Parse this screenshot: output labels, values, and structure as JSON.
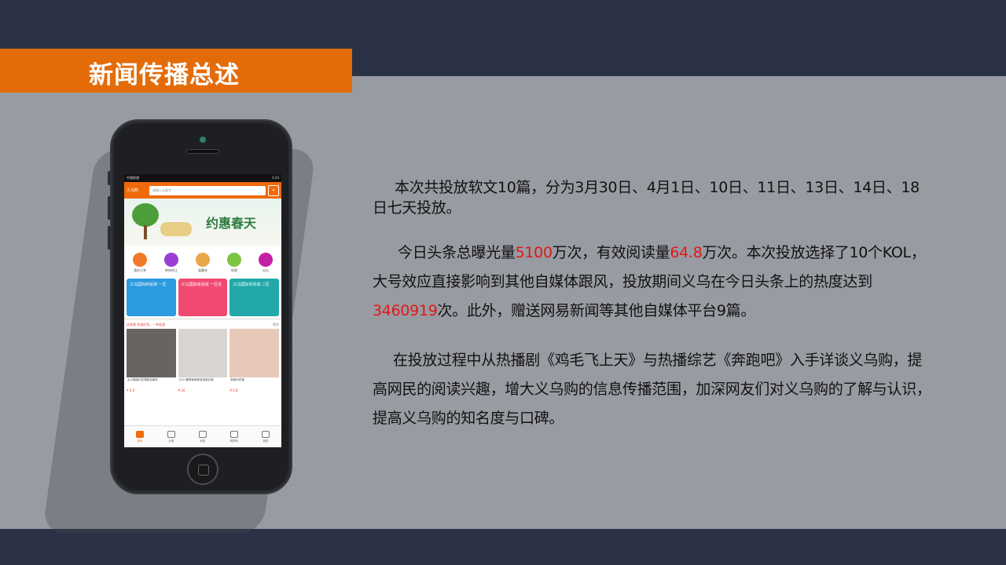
{
  "slide": {
    "title": "新闻传播总述",
    "accent_color": "#e36c09",
    "band_color": "#2b3246",
    "highlight_color": "#e01818"
  },
  "phone": {
    "status_left": "中国联通",
    "status_right": "3:24",
    "app_logo": "义乌购",
    "search_placeholder": "请输入关键字",
    "scan_icon": "scan-icon",
    "banner_text": "约惠春天",
    "quick_icons": [
      {
        "label": "我的订单",
        "color": "#f07a2a"
      },
      {
        "label": "转转转让",
        "color": "#9c3ed6"
      },
      {
        "label": "收藏夹",
        "color": "#e9a84a"
      },
      {
        "label": "地图",
        "color": "#7cc442"
      },
      {
        "label": "论坛",
        "color": "#c51fa3"
      }
    ],
    "cards": [
      {
        "label": "义乌国际商贸城 一区",
        "color": "#2b9ae0"
      },
      {
        "label": "义乌国际商贸城 一区东",
        "color": "#f04a72"
      },
      {
        "label": "义乌国际商贸城 二区",
        "color": "#22a8a8"
      }
    ],
    "section_label": "优选购 优选好货，一件起批",
    "section_more": "更多",
    "products": [
      {
        "caption": "女士韩版印花薄款连裤袜",
        "price": "¥ 4.0",
        "color": "#6a6460"
      },
      {
        "caption": "2017春季新款修身显瘦长裤",
        "price": "¥ 16",
        "color": "#d8d4cf"
      },
      {
        "caption": "新款印花毯",
        "price": "¥ 4.8",
        "color": "#e6c9b8"
      }
    ],
    "tabs": [
      {
        "label": "首页",
        "active": true
      },
      {
        "label": "分类",
        "active": false
      },
      {
        "label": "消息",
        "active": false
      },
      {
        "label": "购物车",
        "active": false
      },
      {
        "label": "我的",
        "active": false
      }
    ]
  },
  "body": {
    "p1": "本次共投放软文10篇，分为3月30日、4月1日、10日、11日、13日、14日、18日七天投放。",
    "p2_a": "今日头条总曝光量",
    "p2_hl1": "5100",
    "p2_b": "万次，有效阅读量",
    "p2_hl2": "64.8",
    "p2_c": "万次。本次投放选择了10个KOL，大号效应直接影响到其他自媒体跟风，投放期间义乌在今日头条上的热度达到",
    "p2_hl3": "3460919",
    "p2_d": "次。此外，赠送网易新闻等其他自媒体平台9篇。",
    "p3": "在投放过程中从热播剧《鸡毛飞上天》与热播综艺《奔跑吧》入手详谈义乌购，提高网民的阅读兴趣，增大义乌购的信息传播范围，加深网友们对义乌购的了解与认识，提高义乌购的知名度与口碑。"
  }
}
